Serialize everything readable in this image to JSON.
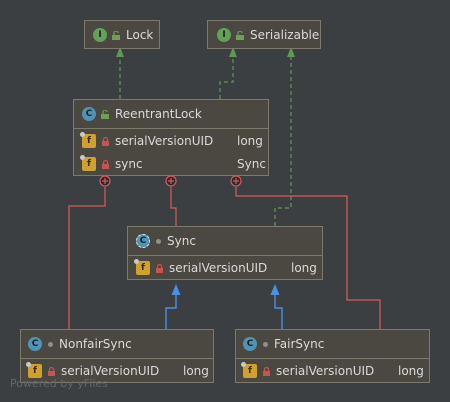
{
  "nodes": {
    "lock": {
      "kind": "I",
      "name": "Lock"
    },
    "serializable": {
      "kind": "I",
      "name": "Serializable"
    },
    "reentrantlock": {
      "kind": "C",
      "name": "ReentrantLock",
      "fields": [
        {
          "kind": "f",
          "name": "serialVersionUID",
          "type": "long"
        },
        {
          "kind": "f",
          "name": "sync",
          "type": "Sync"
        }
      ]
    },
    "sync": {
      "kind": "C",
      "name": "Sync",
      "fields": [
        {
          "kind": "f",
          "name": "serialVersionUID",
          "type": "long"
        }
      ]
    },
    "nonfairsync": {
      "kind": "C",
      "name": "NonfairSync",
      "fields": [
        {
          "kind": "f",
          "name": "serialVersionUID",
          "type": "long"
        }
      ]
    },
    "fairsync": {
      "kind": "C",
      "name": "FairSync",
      "fields": [
        {
          "kind": "f",
          "name": "serialVersionUID",
          "type": "long"
        }
      ]
    }
  },
  "edges": [
    {
      "from": "ReentrantLock",
      "to": "Lock",
      "type": "implements"
    },
    {
      "from": "ReentrantLock",
      "to": "Serializable",
      "type": "implements"
    },
    {
      "from": "Sync",
      "to": "Serializable",
      "type": "implements"
    },
    {
      "from": "NonfairSync",
      "to": "Sync",
      "type": "extends"
    },
    {
      "from": "FairSync",
      "to": "Sync",
      "type": "extends"
    },
    {
      "from": "ReentrantLock",
      "to": "Sync",
      "type": "inner-class"
    },
    {
      "from": "ReentrantLock",
      "to": "NonfairSync",
      "type": "inner-class"
    },
    {
      "from": "ReentrantLock",
      "to": "FairSync",
      "type": "inner-class"
    }
  ],
  "colors": {
    "background": "#3c3f41",
    "box_fill": "#4a4840",
    "box_border": "#7d7a6b",
    "implements_edge": "#5e9a4f",
    "extends_edge": "#4b8fe6",
    "inner_class_edge": "#d85a5a"
  },
  "footer": "Powered by yFiles"
}
